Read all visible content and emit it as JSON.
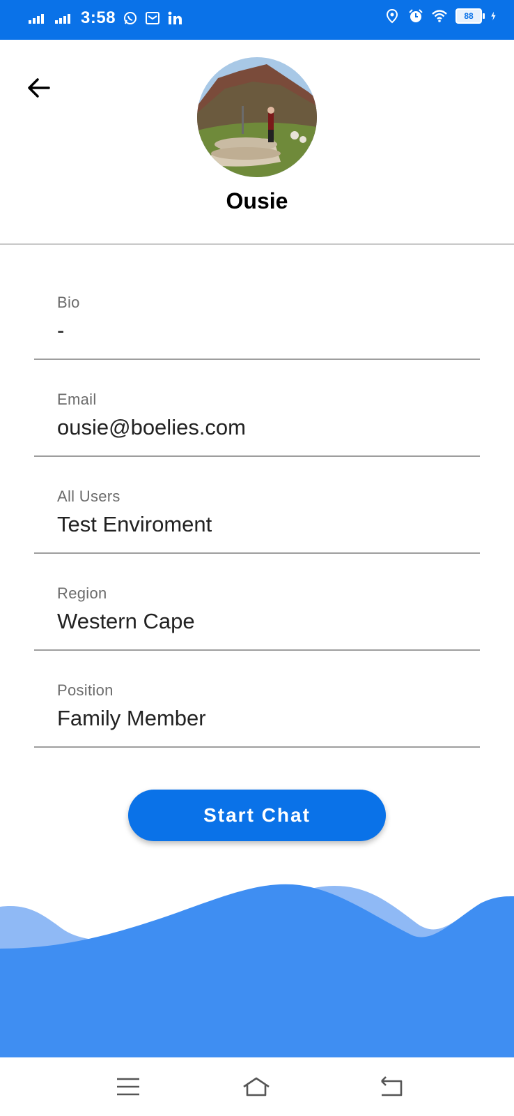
{
  "status_bar": {
    "time": "3:58",
    "battery": "88",
    "icons": [
      "signal-icon",
      "signal-icon",
      "whatsapp-icon",
      "mail-icon",
      "linkedin-icon",
      "location-icon",
      "alarm-icon",
      "wifi-icon",
      "battery-icon",
      "charging-icon"
    ]
  },
  "profile": {
    "name": "Ousie"
  },
  "fields": [
    {
      "label": "Bio",
      "value": "-"
    },
    {
      "label": "Email",
      "value": "ousie@boelies.com"
    },
    {
      "label": "All Users",
      "value": "Test Enviroment"
    },
    {
      "label": "Region",
      "value": "Western Cape"
    },
    {
      "label": "Position",
      "value": "Family Member"
    }
  ],
  "actions": {
    "start_chat": "Start Chat"
  },
  "colors": {
    "accent": "#0a72e8",
    "wave_light": "#8fb9f5",
    "wave_main": "#3f8ef2"
  },
  "nav_bar": {
    "icons": [
      "menu-icon",
      "home-icon",
      "back-nav-icon"
    ]
  }
}
